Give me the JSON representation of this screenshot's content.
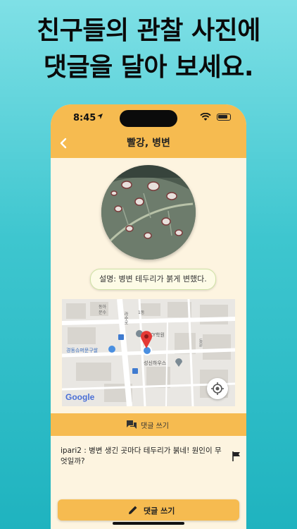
{
  "headline": {
    "line1": "친구들의 관찰 사진에",
    "line2": "댓글을 달아 보세요."
  },
  "status_bar": {
    "time": "8:45"
  },
  "nav": {
    "title": "빨강, 병변"
  },
  "observation": {
    "description": "설명: 병변 테두리가 붉게 변했다."
  },
  "map": {
    "labels": [
      "동아",
      "문수",
      "1동",
      "라수로",
      "SKY학원",
      "경동슈퍼문구쌀",
      "성신하우스",
      "동문"
    ],
    "google": "Google"
  },
  "comment_bar": {
    "label": "댓글 쓰기"
  },
  "comments": [
    {
      "text": "ipari2 : 병변 생긴 곳마다 테두리가 붉네! 원인이 무엇일까?"
    }
  ],
  "write_button": {
    "label": "댓글 쓰기"
  }
}
